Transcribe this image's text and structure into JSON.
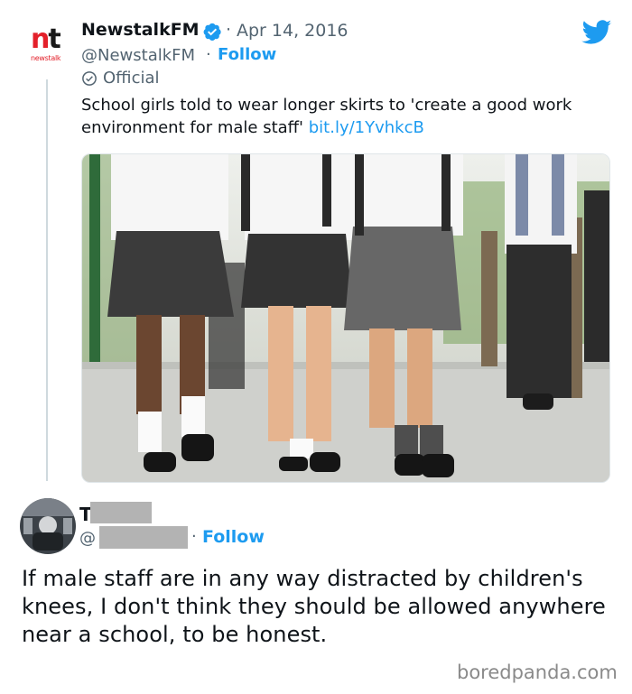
{
  "tweet": {
    "account_name": "NewstalkFM",
    "date": "Apr 14, 2016",
    "date_separator": "·",
    "handle": "@NewstalkFM",
    "handle_separator": "·",
    "follow_label": "Follow",
    "official_label": "Official",
    "text": "School girls told to wear longer skirts to 'create a good work environment for male staff'",
    "link": "bit.ly/1YvhkcB",
    "logo": {
      "mark_n": "n",
      "mark_t": "t",
      "subtext": "newstalk"
    },
    "icons": {
      "verified": "verified-badge-icon",
      "official": "official-check-icon",
      "platform": "twitter-bird-icon"
    },
    "colors": {
      "accent": "#1d9bf0",
      "logo_red": "#e3202a",
      "muted": "#536471"
    }
  },
  "reply": {
    "name_initial": "T",
    "at_symbol": "@",
    "separator": "·",
    "follow_label": "Follow",
    "text": "If male staff are in any way distracted by children's knees, I don't think they should be allowed anywhere near a school, to be honest."
  },
  "watermark": "boredpanda.com"
}
